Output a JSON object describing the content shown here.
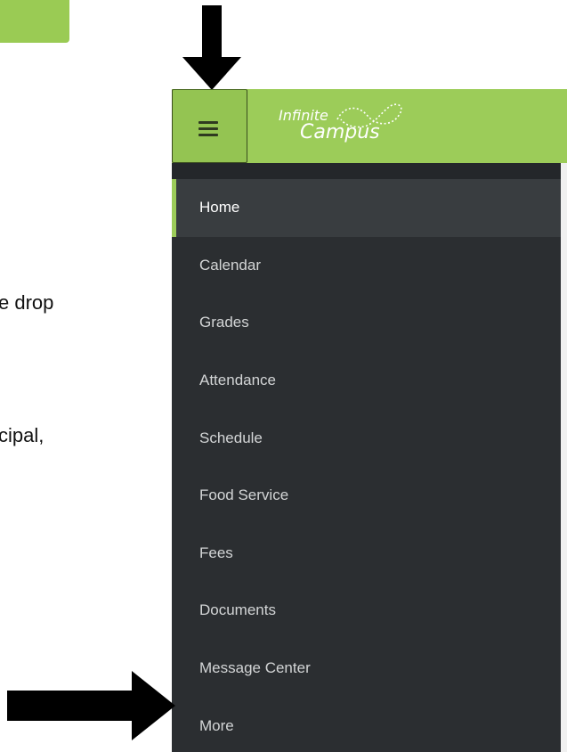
{
  "background": {
    "fragment_1": "e drop",
    "fragment_2": "cipal,"
  },
  "app": {
    "logo_line1": "Infinite",
    "logo_line2": "Campus",
    "accent_color": "#9ccc59",
    "sidebar_bg_color": "#2b2e31",
    "menu": [
      {
        "label": "Home",
        "active": true
      },
      {
        "label": "Calendar"
      },
      {
        "label": "Grades"
      },
      {
        "label": "Attendance"
      },
      {
        "label": "Schedule"
      },
      {
        "label": "Food Service"
      },
      {
        "label": "Fees"
      },
      {
        "label": "Documents"
      },
      {
        "label": "Message Center"
      },
      {
        "label": "More"
      }
    ]
  },
  "annotations": {
    "arrow_color": "#000000",
    "down_arrow_icon": "arrow-down-icon",
    "right_arrow_icon": "arrow-right-icon"
  }
}
